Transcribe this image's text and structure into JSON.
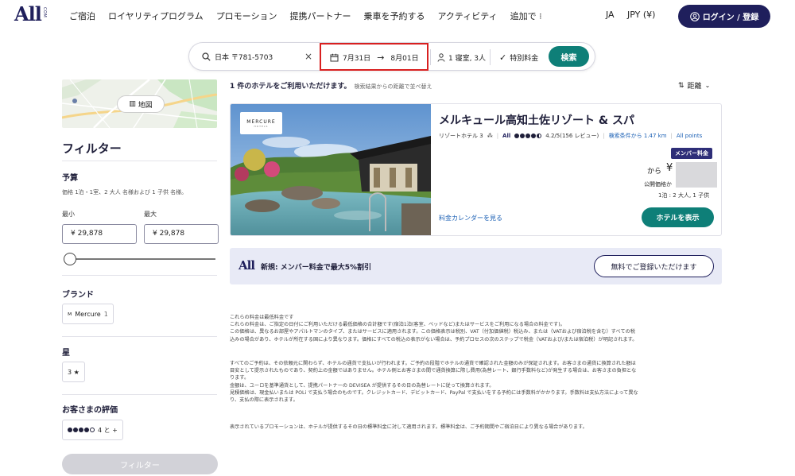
{
  "header": {
    "logo_main": "All",
    "logo_sub": "COM",
    "nav": [
      "ご宿泊",
      "ロイヤリティプログラム",
      "プロモーション",
      "提携パートナー",
      "乗車を予約する",
      "アクティビティ",
      "追加で ⁝"
    ],
    "language": "JA",
    "currency": "JPY (¥)",
    "login_label": "ログイン / 登録"
  },
  "search": {
    "location": "日本 〒781-5703",
    "clear_icon": "×",
    "checkin": "7月31日",
    "checkout": "8月01日",
    "guests": "1 寝室, 3人",
    "special_rate": "特別料金",
    "search_label": "検索"
  },
  "sidebar": {
    "map_label": "地図",
    "filter_title": "フィルター",
    "budget_title": "予算",
    "budget_note": "価格 1泊・1室、2 大人 名様および 1 子供 名様。",
    "min_label": "最小",
    "max_label": "最大",
    "min_value": "¥ 29,878",
    "max_value": "¥ 29,878",
    "slider_value": 0,
    "brand_title": "ブランド",
    "brand_chip": "Mercure",
    "brand_count": "1",
    "star_title": "星",
    "star_chip": "3 ★",
    "rating_title": "お客さまの評価",
    "rating_chip": "4 と +",
    "filter_button": "フィルター"
  },
  "results": {
    "count_text": "1 件のホテルをご利用いただけます。",
    "sort_note": "検索結果からの距離で並べ替え",
    "sort_label": "距離",
    "hotel": {
      "brand_badge": "MERCURE",
      "brand_badge_sub": "HOTELS",
      "name": "メルキュール高知土佐リゾート & スパ",
      "type": "リゾートホテル 3",
      "rating": "4.2/5(156 レビュー)",
      "rating_dots": 4.2,
      "distance": "検索条件から 1.47 km",
      "all_points": "All points",
      "member_badge": "メンバー料金",
      "price_from": "から",
      "price_currency": "¥",
      "public_price": "公開価格か",
      "per_stay": "1泊 : 2 大人, 1 子供",
      "rate_calendar": "料金カレンダーを見る",
      "view_button": "ホテルを表示"
    },
    "promo": {
      "logo": "All",
      "text": "新規: メンバー料金で最大5%割引",
      "button": "無料でご登録いただけます"
    }
  },
  "disclaimer": {
    "p1": [
      "これらの料金は最低料金です",
      "これらの料金は、ご指定の日付にご利用いただける最低価格の合計額です(宿泊1泊(客室、ベッドなど)またはサービスをご利用になる場合の料金です)。",
      "この価格は、異なるお部屋やアパルトマンのタイプ、またはサービスに適用されます。この価格表示は税別、VAT（付加価値税）税込み、または（VATおよび宿泊税を含む）すべての税",
      "込みの場合があり、ホテルが所在する国により異なります。価格にすべての税込の表示がない場合は、予約プロセスの次のステップで税金（VATおよび/または宿泊税）が明記されます。"
    ],
    "p2": [
      "すべてのご予約は、その依頼元に関わらず、ホテルの通貨で支払いが行われます。ご予約の段階でホテルの通貨で確認された金額のみが保証されます。お客さまの通貨に換算された額は",
      "目安として提示されたものであり、契約上の金額ではありません。ホテル側とお客さまの間で通貨換算に際し費用(為替レート、銀行手数料など)が発生する場合は、お客さまの負担とな",
      "ります。",
      "金額は、ユーロを基準通貨として、提携パートナーの DEVISEA が提供するその日の為替レートに従って換算されます。",
      "見積価格は、現金払いまたは POLi で支払う場合のものです。クレジットカード、デビットカード、PayPal で支払いをする予約には手数料がかかります。手数料は支払方法によって異な",
      "り、支払の際に表示されます。"
    ],
    "p3": [
      "表示されているプロモーションは、ホテルが提供するその日の標準料金に対して適用されます。標準料金は、ご予約期間やご宿泊日により異なる場合があります。"
    ]
  },
  "colors": {
    "brand_navy": "#1f1f5c",
    "teal": "#0e7f78",
    "highlight_red": "#d82020",
    "promo_bg": "#e8eaf6"
  }
}
